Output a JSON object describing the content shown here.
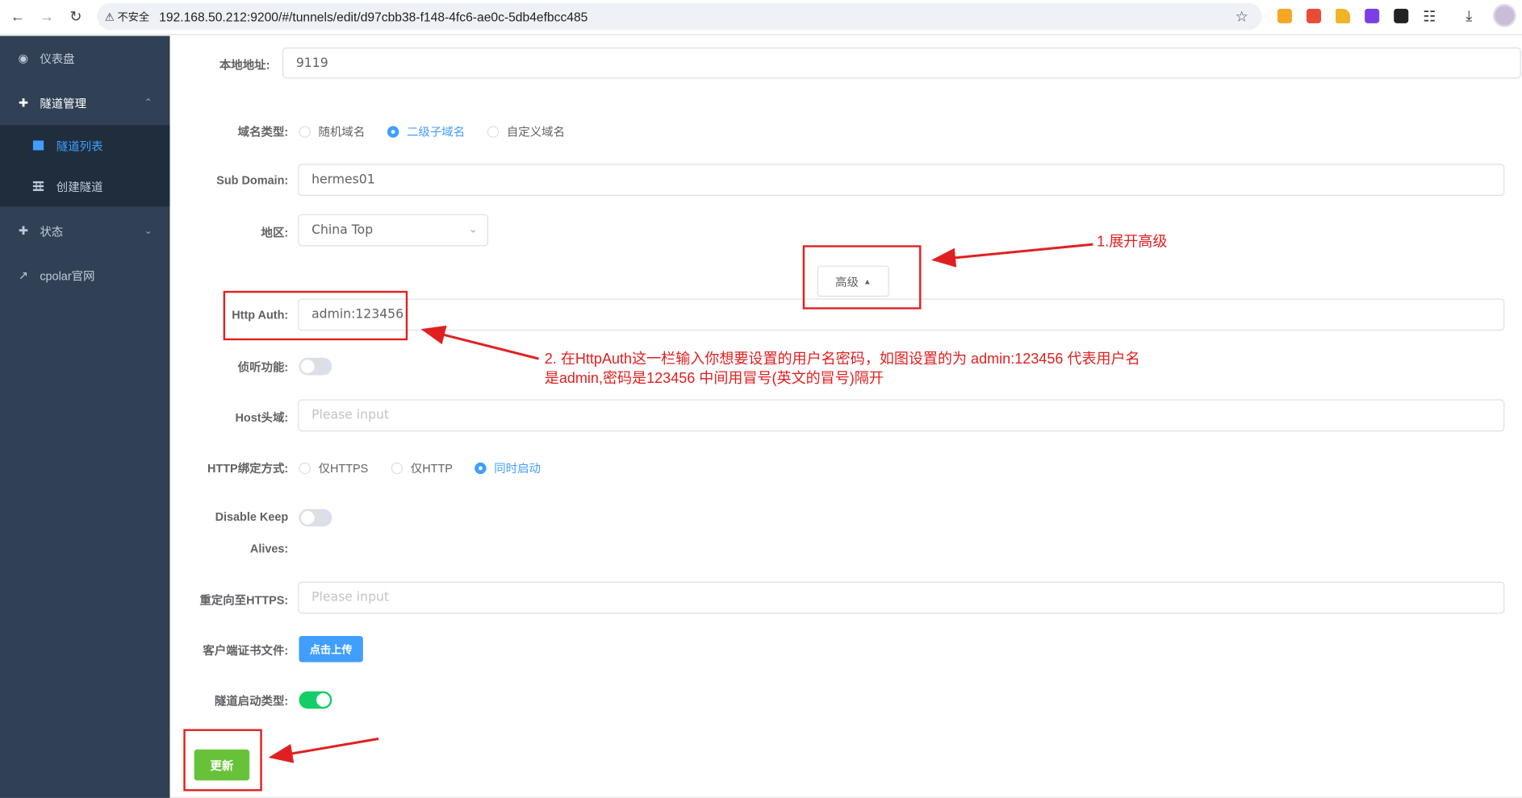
{
  "browser": {
    "security_label": "不安全",
    "url": "192.168.50.212:9200/#/tunnels/edit/d97cbb38-f148-4fc6-ae0c-5db4efbcc485",
    "extension_colors": [
      "#f5a623",
      "#e94b35",
      "#f0b429",
      "#7b3fe4",
      "#222222"
    ]
  },
  "sidebar": {
    "items": [
      {
        "label": "仪表盘",
        "icon": "dashboard-icon"
      },
      {
        "label": "隧道管理",
        "icon": "tunnel-icon",
        "expanded": true
      },
      {
        "label": "隧道列表",
        "icon": "grid-icon",
        "active": true
      },
      {
        "label": "创建隧道",
        "icon": "grid-icon"
      },
      {
        "label": "状态",
        "icon": "status-icon",
        "expanded": false
      },
      {
        "label": "cpolar官网",
        "icon": "external-link-icon"
      }
    ]
  },
  "form": {
    "local_addr": {
      "label": "本地地址:",
      "value": "9119"
    },
    "domain_type": {
      "label": "域名类型:",
      "options": [
        "随机域名",
        "二级子域名",
        "自定义域名"
      ],
      "selected": "二级子域名"
    },
    "sub_domain": {
      "label": "Sub Domain:",
      "value": "hermes01"
    },
    "region": {
      "label": "地区:",
      "value": "China Top"
    },
    "advanced_button": "高级",
    "http_auth": {
      "label": "Http Auth:",
      "value": "admin:123456"
    },
    "listen": {
      "label": "侦听功能:",
      "on": false
    },
    "host_header": {
      "label": "Host头域:",
      "placeholder": "Please input"
    },
    "http_bind": {
      "label": "HTTP绑定方式:",
      "options": [
        "仅HTTPS",
        "仅HTTP",
        "同时启动"
      ],
      "selected": "同时启动"
    },
    "disable_keepalives": {
      "label_line1": "Disable Keep",
      "label_line2": "Alives:",
      "on": false
    },
    "redirect_https": {
      "label": "重定向至HTTPS:",
      "placeholder": "Please input"
    },
    "client_cert": {
      "label": "客户端证书文件:",
      "button": "点击上传"
    },
    "startup_type": {
      "label": "隧道启动类型:",
      "on": true
    },
    "submit_button": "更新"
  },
  "annotations": {
    "step1": "1.展开高级",
    "step2_line1": "2. 在HttpAuth这一栏输入你想要设置的用户名密码，如图设置的为 admin:123456 代表用户名",
    "step2_line2": "是admin,密码是123456  中间用冒号(英文的冒号)隔开",
    "color": "#e02020"
  },
  "colors": {
    "sidebar_bg": "#304156",
    "submenu_bg": "#1f2d3d",
    "primary": "#409eff",
    "success": "#67c23a",
    "switch_on": "#13ce66"
  }
}
